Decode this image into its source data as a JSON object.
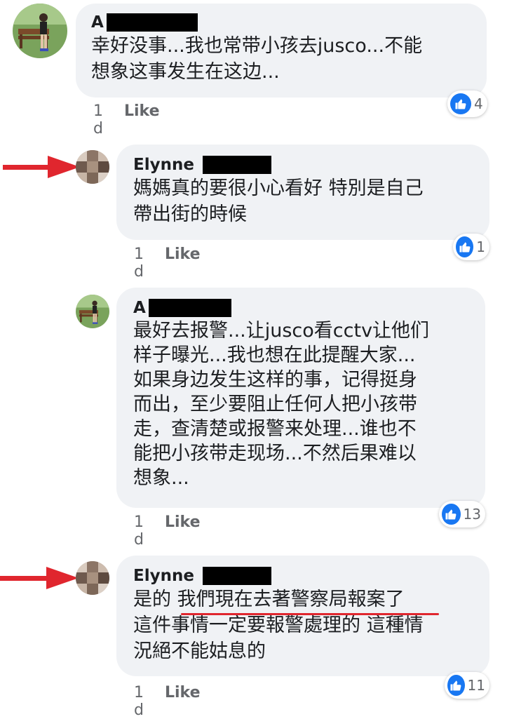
{
  "comments": [
    {
      "author": "A",
      "text": "幸好没事...我也常带小孩去jusco...不能\n想象这事发生在这边...",
      "time": "1 d",
      "like_label": "Like",
      "reaction_count": "4"
    },
    {
      "author": "Elynne",
      "text": "媽媽真的要很小心看好 特別是自己\n帶出街的時候",
      "time": "1 d",
      "like_label": "Like",
      "reaction_count": "1"
    },
    {
      "author": "A",
      "text": "最好去报警...让jusco看cctv让他们\n样子曝光...我也想在此提醒大家...\n如果身边发生这样的事，记得挺身\n而出，至少要阻止任何人把小孩带\n走，查清楚或报警来处理...谁也不\n能把小孩带走现场...不然后果难以\n想象...",
      "time": "1 d",
      "like_label": "Like",
      "reaction_count": "13"
    },
    {
      "author": "Elynne",
      "text": "是的 我們現在去著警察局報案了\n這件事情一定要報警處理的 這種情\n況絕不能姑息的",
      "time": "1 d",
      "like_label": "Like",
      "reaction_count": "11"
    }
  ],
  "colors": {
    "bubble": "#f0f2f5",
    "like_blue": "#1877f2",
    "annotation_red": "#e0262e",
    "meta_gray": "#65676b"
  },
  "icons": {
    "reaction": "thumbs-up-icon",
    "annotation": "red-arrow-icon"
  }
}
